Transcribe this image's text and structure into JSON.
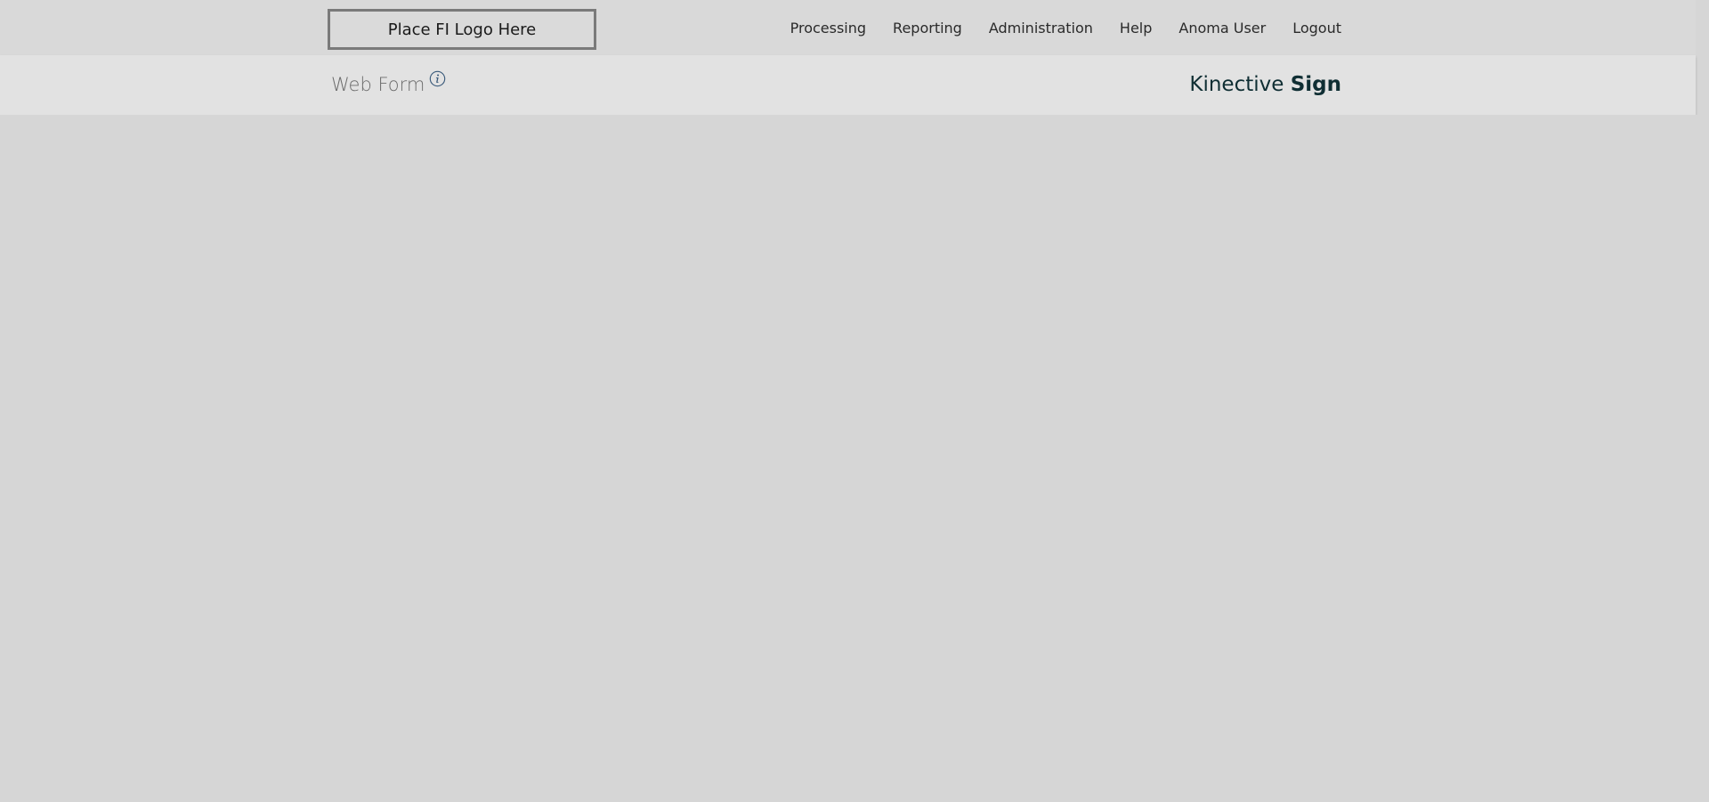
{
  "header": {
    "logo_text": "Place FI Logo Here",
    "nav": [
      {
        "label": "Processing"
      },
      {
        "label": "Reporting"
      },
      {
        "label": "Administration"
      },
      {
        "label": "Help"
      },
      {
        "label": "Anoma User"
      },
      {
        "label": "Logout"
      }
    ]
  },
  "subheader": {
    "title": "Web Form",
    "info_icon": "info-circle-icon",
    "brand_light": "Kinective",
    "brand_bold": "Sign"
  },
  "colors": {
    "background": "#d6d6d6",
    "subheader_bg": "#e2e2e2",
    "brand_color": "#0f2e33",
    "info_icon_color": "#3a5a7a"
  }
}
